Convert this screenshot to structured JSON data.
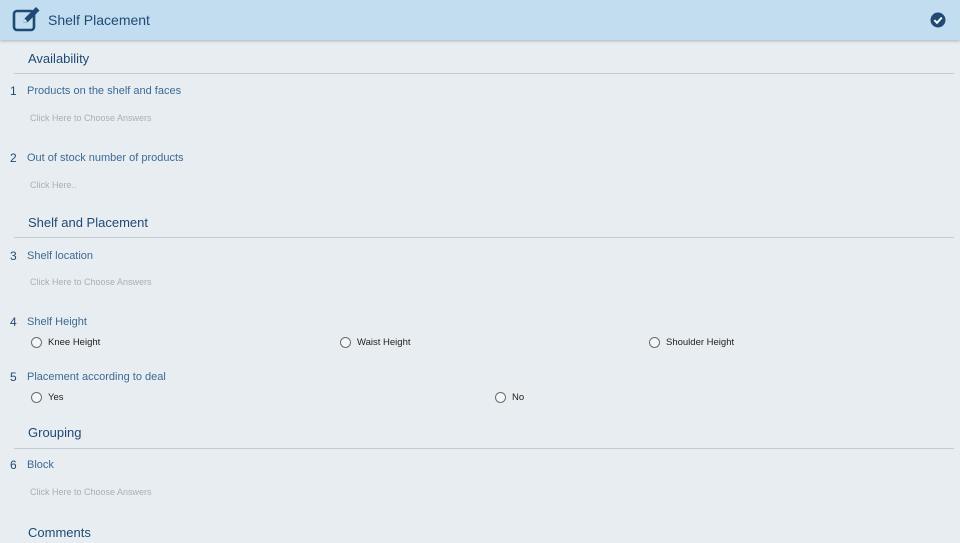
{
  "header": {
    "title": "Shelf Placement"
  },
  "sections": {
    "availability": "Availability",
    "shelf_and_placement": "Shelf and Placement",
    "grouping": "Grouping",
    "comments": "Comments"
  },
  "questions": {
    "q1": {
      "number": "1",
      "label": "Products on the shelf and faces",
      "hint": "Click Here to Choose Answers"
    },
    "q2": {
      "number": "2",
      "label": "Out of stock number of products",
      "hint": "Click Here.."
    },
    "q3": {
      "number": "3",
      "label": "Shelf location",
      "hint": "Click Here to Choose Answers"
    },
    "q4": {
      "number": "4",
      "label": "Shelf Height",
      "options": [
        "Knee Height",
        "Waist Height",
        "Shoulder Height"
      ]
    },
    "q5": {
      "number": "5",
      "label": "Placement according to deal",
      "options": [
        "Yes",
        "No"
      ]
    },
    "q6": {
      "number": "6",
      "label": "Block",
      "hint": "Click Here to Choose Answers"
    }
  },
  "colors": {
    "header_bg": "#c2ddf0",
    "accent": "#1f4a75"
  }
}
